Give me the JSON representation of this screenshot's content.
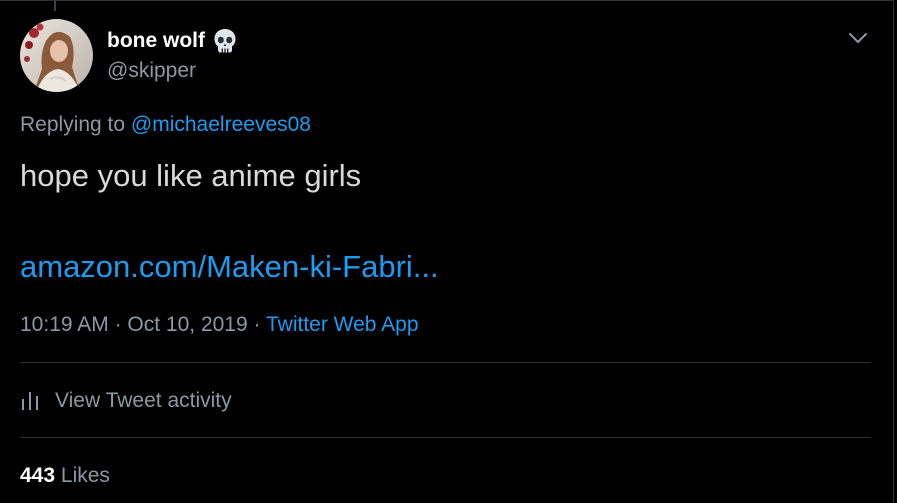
{
  "tweet": {
    "author": {
      "display_name": "bone wolf",
      "emoji": "skull",
      "handle": "@skipper"
    },
    "reply": {
      "prefix": "Replying to",
      "mention": "@michaelreeves08"
    },
    "text": "hope you like anime girls",
    "link": "amazon.com/Maken-ki-Fabri...",
    "meta": {
      "time": "10:19 AM",
      "separator1": "·",
      "date": "Oct 10, 2019",
      "separator2": "·",
      "source": "Twitter Web App"
    },
    "activity_label": "View Tweet activity",
    "likes": {
      "count": "443",
      "label": "Likes"
    }
  },
  "icons": {
    "more": "chevron-down-icon",
    "activity": "bar-chart-icon"
  },
  "colors": {
    "background": "#000000",
    "text": "#d9d9d9",
    "secondary_text": "#8b98a5",
    "link": "#1d9bf0",
    "divider": "#2f3336"
  }
}
